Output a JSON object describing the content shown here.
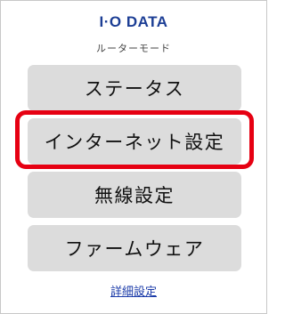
{
  "header": {
    "logo_text": "I·O DATA",
    "mode_label": "ルーターモード"
  },
  "menu": {
    "status": "ステータス",
    "internet": "インターネット設定",
    "wireless": "無線設定",
    "firmware": "ファームウェア"
  },
  "footer": {
    "advanced_link": "詳細設定"
  },
  "colors": {
    "brand": "#1c3e95",
    "button_bg": "#dcdcdc",
    "highlight": "#e60012",
    "link": "#1a3aa8"
  }
}
